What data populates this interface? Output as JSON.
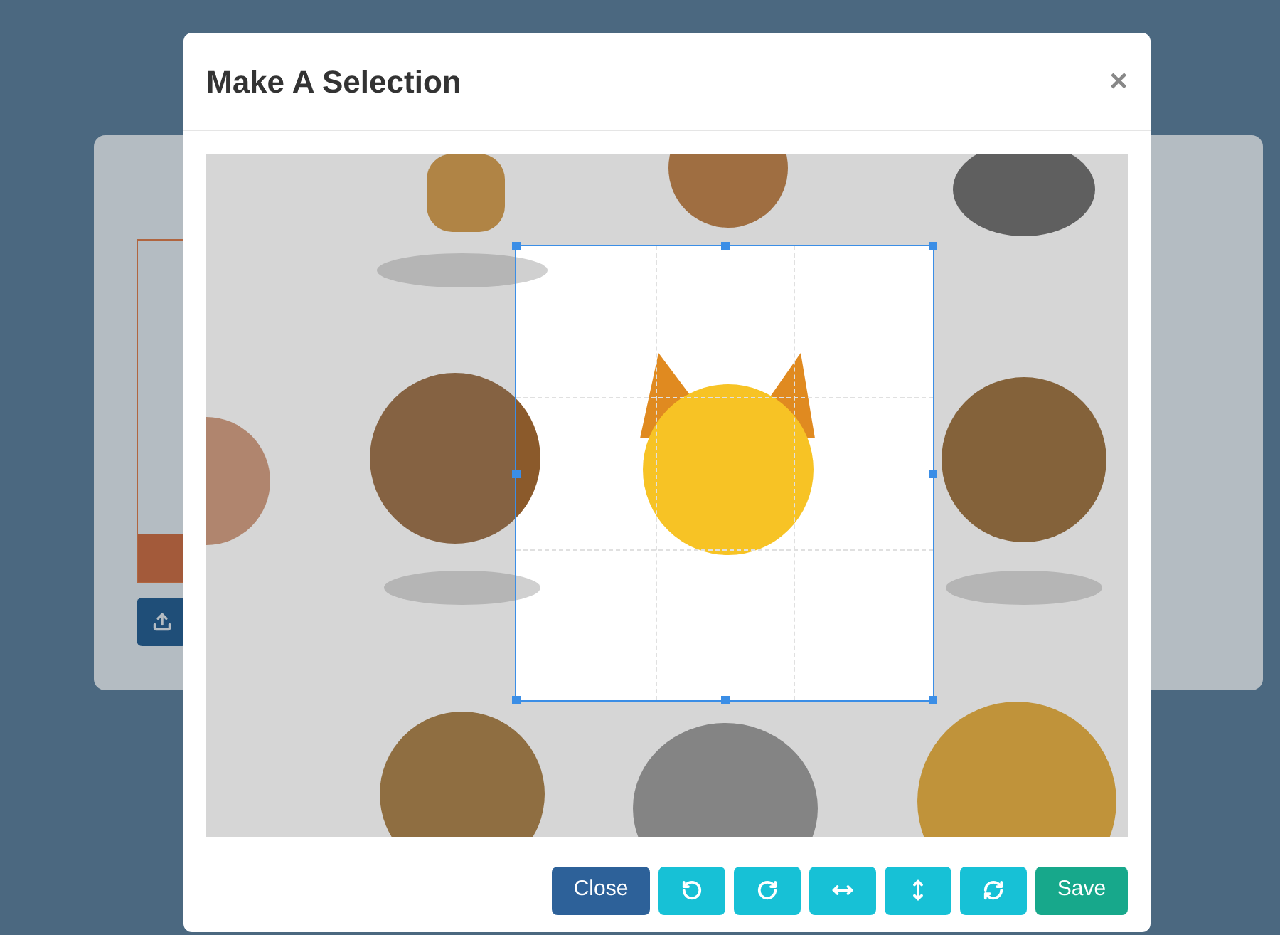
{
  "modal": {
    "title": "Make A Selection",
    "close": "×"
  },
  "buttons": [
    {
      "kind": "close",
      "label": "Close"
    },
    {
      "kind": "rotate-left"
    },
    {
      "kind": "rotate-right"
    },
    {
      "kind": "flip-horizontal"
    },
    {
      "kind": "flip-vertical"
    },
    {
      "kind": "reset"
    },
    {
      "kind": "save",
      "label": "Save"
    }
  ]
}
